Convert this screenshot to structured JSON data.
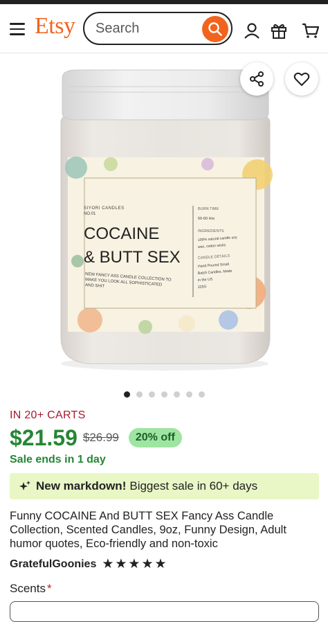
{
  "header": {
    "logo": "Etsy",
    "search_placeholder": "Search"
  },
  "product_image": {
    "label": {
      "brand_line1": "SIYORI CANDLES",
      "brand_line2": "NO.01",
      "headline1": "COCAINE",
      "headline2": "& BUTT SEX",
      "sub1": "NEW FANCY ASS CANDLE COLLECTION TO",
      "sub2": "MAKE YOU LOOK ALL SOPHISTICATED",
      "sub3": "AND SHIT",
      "burn_title": "BURN TIME",
      "burn_value": "50-60 Hrs",
      "ingredients_title": "INGREDIENTS",
      "ingredients_1": "100% natural candle soy",
      "ingredients_2": "wax, cotton wicks",
      "details_title": "CANDLE DETAILS",
      "details_1": "Hand Poured Small",
      "details_2": "Batch Candles. Made",
      "details_3": "in the US",
      "details_4": "225G"
    },
    "slide_count": 7,
    "active_slide": 1
  },
  "carts_text": "IN 20+ CARTS",
  "price": "$21.59",
  "original_price": "$26.99",
  "discount_badge": "20% off",
  "sale_ends": "Sale ends in 1 day",
  "markdown": {
    "strong": "New markdown!",
    "text": "Biggest sale in 60+ days"
  },
  "title": "Funny COCAINE And BUTT SEX Fancy Ass Candle Collection, Scented Candles, 9oz, Funny Design, Adult humor quotes, Eco-friendly and non-toxic",
  "shop_name": "GratefulGoonies",
  "rating": 5,
  "stars": "★★★★★",
  "variation_label": "Scents",
  "required_mark": "*",
  "colors": {
    "etsy_orange": "#F1641E",
    "price_green": "#258635",
    "carts_red": "#A61A2E",
    "badge_green": "#9EE5A2",
    "markdown_bg": "#E9F6C6"
  }
}
